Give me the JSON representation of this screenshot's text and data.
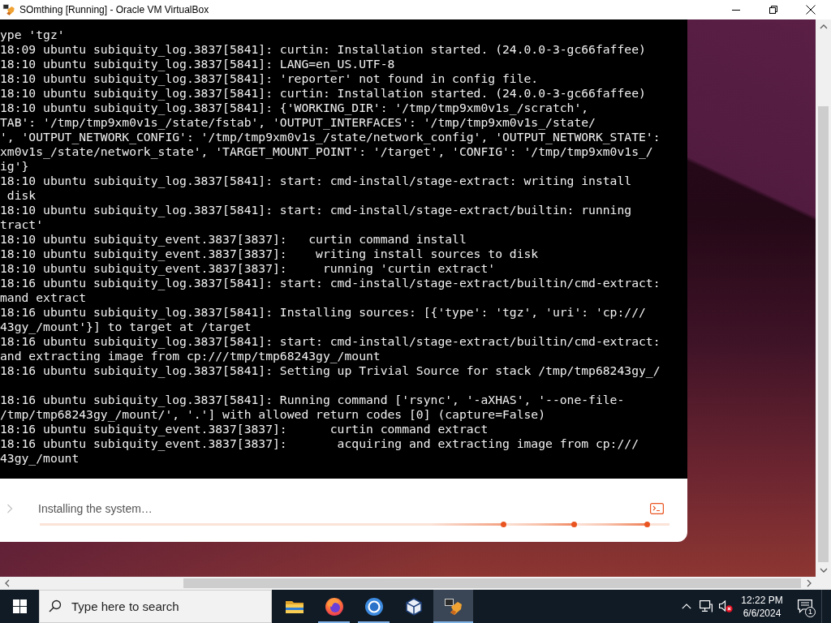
{
  "window": {
    "title": "SOmthing [Running] - Oracle VM VirtualBox"
  },
  "terminal": {
    "lines": [
      {
        "kind": "text",
        "text": "ype 'tgz'"
      },
      {
        "kind": "text",
        "text": "18:09 ubuntu subiquity_log.3837[5841]: curtin: Installation started. (24.0.0-3-gc66faffee)"
      },
      {
        "kind": "text",
        "text": "18:10 ubuntu subiquity_log.3837[5841]: LANG=en_US.UTF-8"
      },
      {
        "kind": "text",
        "text": "18:10 ubuntu subiquity_log.3837[5841]: 'reporter' not found in config file."
      },
      {
        "kind": "text",
        "text": "18:10 ubuntu subiquity_log.3837[5841]: curtin: Installation started. (24.0.0-3-gc66faffee)"
      },
      {
        "kind": "text",
        "text": "18:10 ubuntu subiquity_log.3837[5841]: {'WORKING_DIR': '/tmp/tmp9xm0v1s_/scratch',"
      },
      {
        "kind": "text",
        "text": "TAB': '/tmp/tmp9xm0v1s_/state/fstab', 'OUTPUT_INTERFACES': '/tmp/tmp9xm0v1s_/state/"
      },
      {
        "kind": "text",
        "text": "', 'OUTPUT_NETWORK_CONFIG': '/tmp/tmp9xm0v1s_/state/network_config', 'OUTPUT_NETWORK_STATE':"
      },
      {
        "kind": "text",
        "text": "xm0v1s_/state/network_state', 'TARGET_MOUNT_POINT': '/target', 'CONFIG': '/tmp/tmp9xm0v1s_/"
      },
      {
        "kind": "text",
        "text": "ig'}"
      },
      {
        "kind": "text",
        "text": "18:10 ubuntu subiquity_log.3837[5841]: start: cmd-install/stage-extract: writing install"
      },
      {
        "kind": "text",
        "text": " disk"
      },
      {
        "kind": "text",
        "text": "18:10 ubuntu subiquity_log.3837[5841]: start: cmd-install/stage-extract/builtin: running"
      },
      {
        "kind": "text",
        "text": "tract'"
      },
      {
        "kind": "text",
        "text": "18:10 ubuntu subiquity_event.3837[3837]:   curtin command install"
      },
      {
        "kind": "text",
        "text": "18:10 ubuntu subiquity_event.3837[3837]:    writing install sources to disk"
      },
      {
        "kind": "text",
        "text": "18:10 ubuntu subiquity_event.3837[3837]:     running 'curtin extract'"
      },
      {
        "kind": "text",
        "text": "18:16 ubuntu subiquity_log.3837[5841]: start: cmd-install/stage-extract/builtin/cmd-extract:"
      },
      {
        "kind": "text",
        "text": "mand extract"
      },
      {
        "kind": "text",
        "text": "18:16 ubuntu subiquity_log.3837[5841]: Installing sources: [{'type': 'tgz', 'uri': 'cp:///"
      },
      {
        "kind": "text",
        "text": "43gy_/mount'}] to target at /target"
      },
      {
        "kind": "text",
        "text": "18:16 ubuntu subiquity_log.3837[5841]: start: cmd-install/stage-extract/builtin/cmd-extract:"
      },
      {
        "kind": "text",
        "text": "and extracting image from cp:///tmp/tmp68243gy_/mount"
      },
      {
        "kind": "text",
        "text": "18:16 ubuntu subiquity_log.3837[5841]: Setting up Trivial Source for stack /tmp/tmp68243gy_/"
      },
      {
        "kind": "blank"
      },
      {
        "kind": "text",
        "text": "18:16 ubuntu subiquity_log.3837[5841]: Running command ['rsync', '-aXHAS', '--one-file-"
      },
      {
        "kind": "text",
        "text": "/tmp/tmp68243gy_/mount/', '.'] with allowed return codes [0] (capture=False)"
      },
      {
        "kind": "text",
        "text": "18:16 ubuntu subiquity_event.3837[3837]:      curtin command extract"
      },
      {
        "kind": "text",
        "text": "18:16 ubuntu subiquity_event.3837[3837]:       acquiring and extracting image from cp:///"
      },
      {
        "kind": "text",
        "text": "43gy_/mount"
      }
    ]
  },
  "installer": {
    "status": "Installing the system…"
  },
  "taskbar": {
    "search": {
      "placeholder": "Type here to search"
    },
    "apps": [
      {
        "kind": "folder",
        "running": false,
        "selected": false
      },
      {
        "kind": "flame",
        "running": true,
        "selected": false
      },
      {
        "kind": "ring",
        "running": true,
        "selected": false
      },
      {
        "kind": "cube",
        "running": false,
        "selected": false
      },
      {
        "kind": "machine",
        "running": true,
        "selected": true
      }
    ],
    "tray": {
      "volume": {
        "muted": true
      },
      "clock": {
        "time": "12:22 PM",
        "date": "6/6/2024"
      },
      "notifications": {
        "count": "1"
      }
    }
  }
}
